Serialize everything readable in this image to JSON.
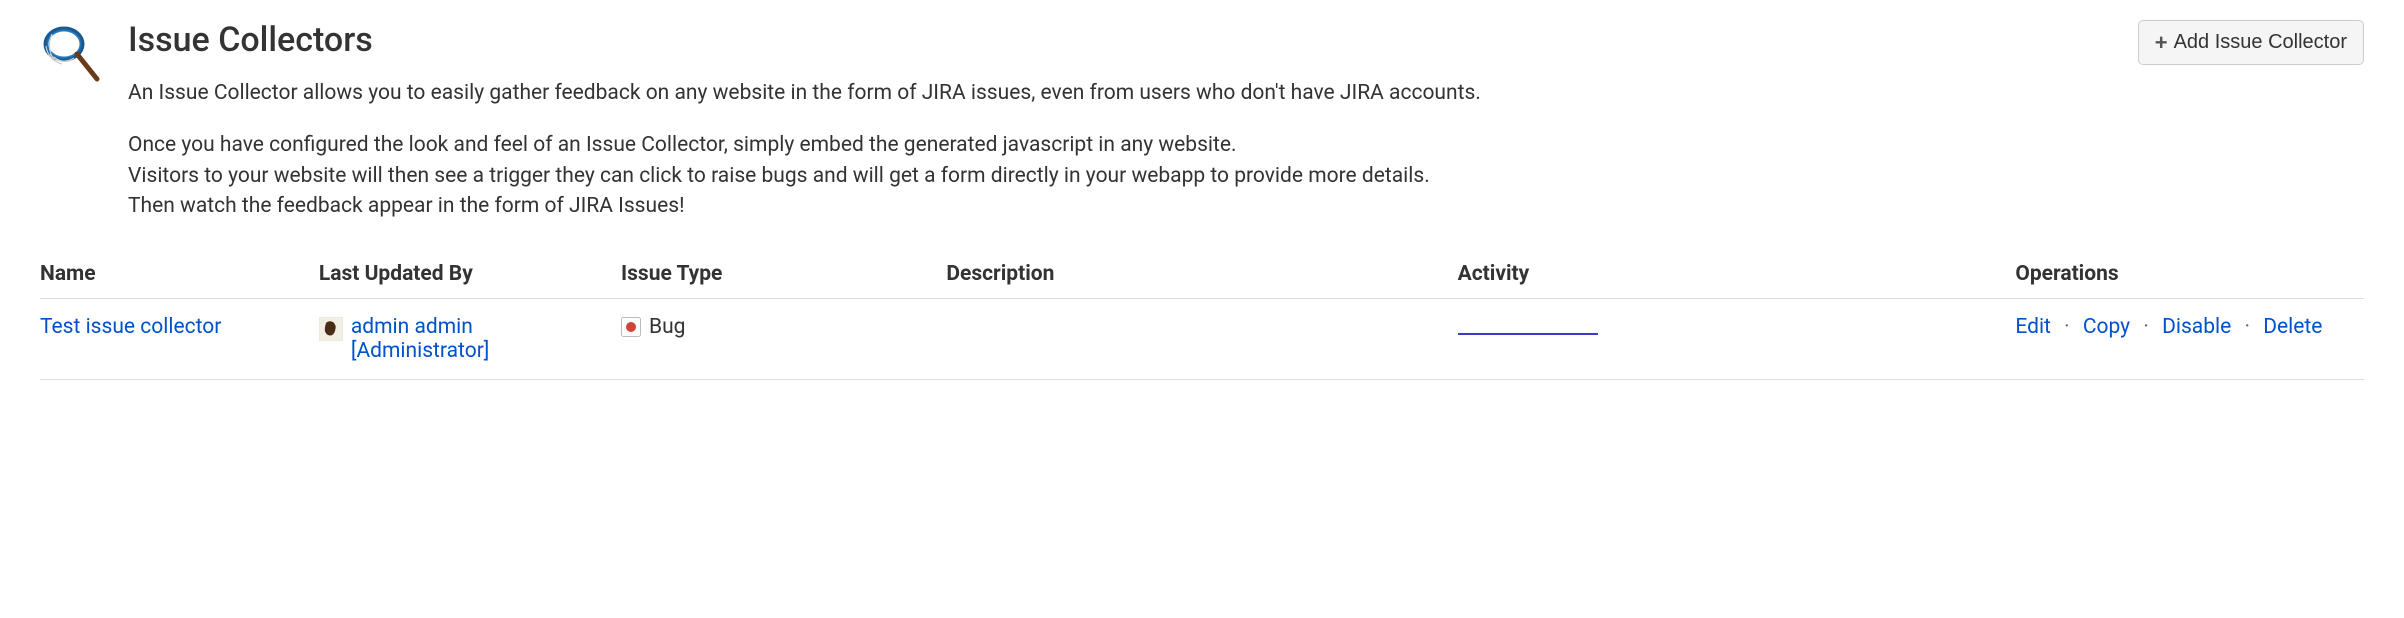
{
  "header": {
    "title": "Issue Collectors",
    "add_button_label": "Add Issue Collector",
    "intro": "An Issue Collector allows you to easily gather feedback on any website in the form of JIRA issues, even from users who don't have JIRA accounts.",
    "details_line1": "Once you have configured the look and feel of an Issue Collector, simply embed the generated javascript in any website.",
    "details_line2": "Visitors to your website will then see a trigger they can click to raise bugs and will get a form directly in your webapp to provide more details.",
    "details_line3": "Then watch the feedback appear in the form of JIRA Issues!"
  },
  "table": {
    "columns": {
      "name": "Name",
      "updated_by": "Last Updated By",
      "issue_type": "Issue Type",
      "description": "Description",
      "activity": "Activity",
      "operations": "Operations"
    },
    "rows": [
      {
        "name": "Test issue collector",
        "updated_by": "admin admin [Administrator]",
        "issue_type": "Bug",
        "description": "",
        "ops": {
          "edit": "Edit",
          "copy": "Copy",
          "disable": "Disable",
          "delete": "Delete"
        }
      }
    ]
  }
}
